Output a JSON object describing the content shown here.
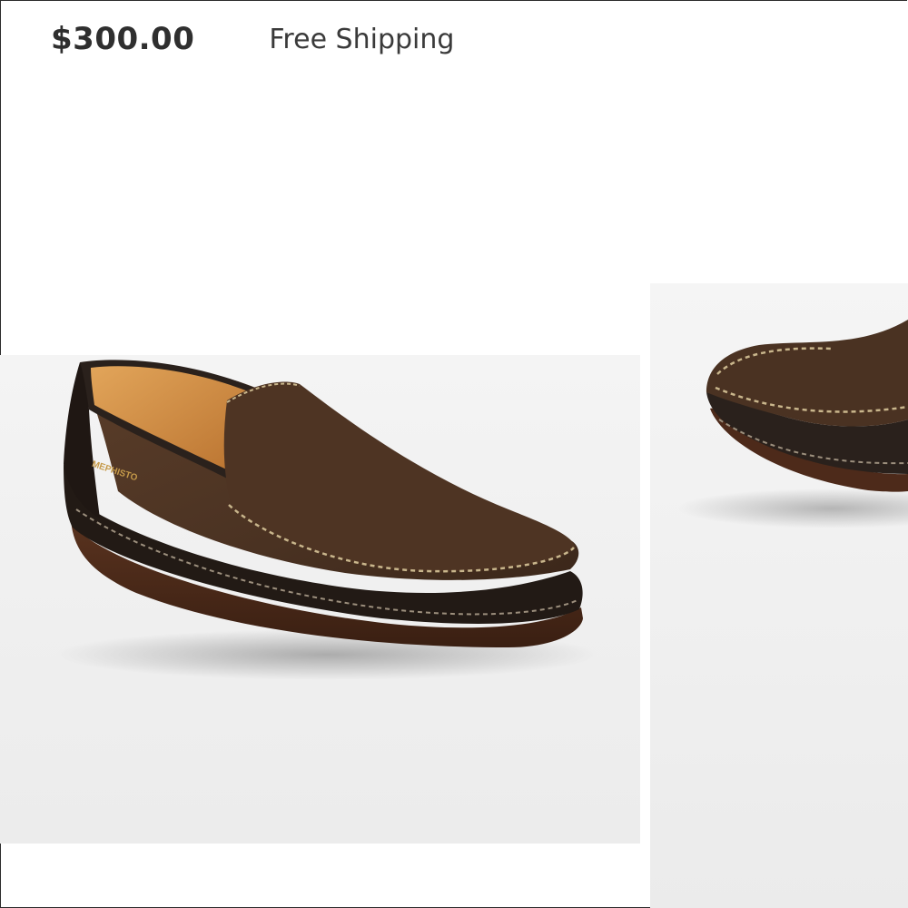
{
  "listing": {
    "price": "$300.00",
    "shipping": "Free Shipping"
  },
  "photos": [
    {
      "subject": "shoe-photo",
      "view": "side"
    },
    {
      "subject": "shoe-photo",
      "view": "close-up"
    }
  ],
  "product": {
    "logo_text": "MEPHISTO",
    "colors": {
      "suede": "#4a3222",
      "leather": "#221a15",
      "sole": "#4d2a1a",
      "lining": "#c98a43",
      "stitching": "#c9b68c"
    }
  }
}
